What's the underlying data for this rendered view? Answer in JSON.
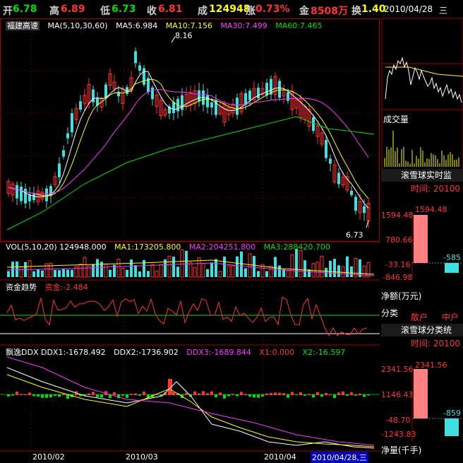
{
  "quote": {
    "open_label": "开",
    "open": "6.78",
    "high_label": "高",
    "high": "6.89",
    "low_label": "低",
    "low": "6.73",
    "close_label": "收",
    "close": "6.81",
    "volume_label": "成",
    "volume": "124948",
    "change_label": "涨",
    "change": "0.73%",
    "amount_label": "金",
    "amount": "8508万",
    "turnover_label": "换",
    "turnover": "1.40",
    "date": "2010/04/28",
    "weekday": "三"
  },
  "main": {
    "stock_name": "福建高速",
    "ma_label": "MA(5,10,30,60)",
    "ma5": "MA5:6.984",
    "ma10": "MA10:7.156",
    "ma30": "MA30:7.499",
    "ma60": "MA60:7.465",
    "high_marker": "8.16",
    "low_marker": "6.73"
  },
  "vol": {
    "label": "VOL(5,10,20) 124948.000",
    "ma1": "MA1:173205.800",
    "ma2": "MA2:204251.800",
    "ma3": "MA3:288420.700"
  },
  "fund": {
    "label": "资金趋势",
    "value": "资金:-2.484"
  },
  "ddx": {
    "label": "飘逸DDX DDX1:-1678.492",
    "ddx2": "DDX2:-1736.902",
    "ddx3": "DDX3:-1689.844",
    "x1": "X1:0.000",
    "x2": "X2:-16.597"
  },
  "xaxis": {
    "labels": [
      "2010/02",
      "2010/03",
      "2010/04"
    ],
    "cursor_date": "2010/04/28,三"
  },
  "right": {
    "volume_title": "成交量",
    "monitor_title": "滚雪球实时监",
    "time_label": "时间: 20100",
    "bar1_top": "1594.48",
    "bar1_axis_top": "1594.48",
    "bar1_axis_mid": "780.66",
    "bar1_axis_low": "-33.16",
    "bar1_axis_bottom": "-846.98",
    "bar1_neg": "-585",
    "net_label": "净额(万元)",
    "category_label": "分类",
    "retail_label": "散户",
    "mid_label": "中户",
    "class_title": "滚雪球分类统",
    "time_label2": "时间: 20100",
    "bar2_top": "2341.56",
    "bar2_axis_top": "2341.56",
    "bar2_axis_mid": "1146.43",
    "bar2_axis_low": "-48.70",
    "bar2_axis_bottom": "-1243.83",
    "bar2_neg": "-859",
    "net_vol_label": "净量(千手)"
  }
}
